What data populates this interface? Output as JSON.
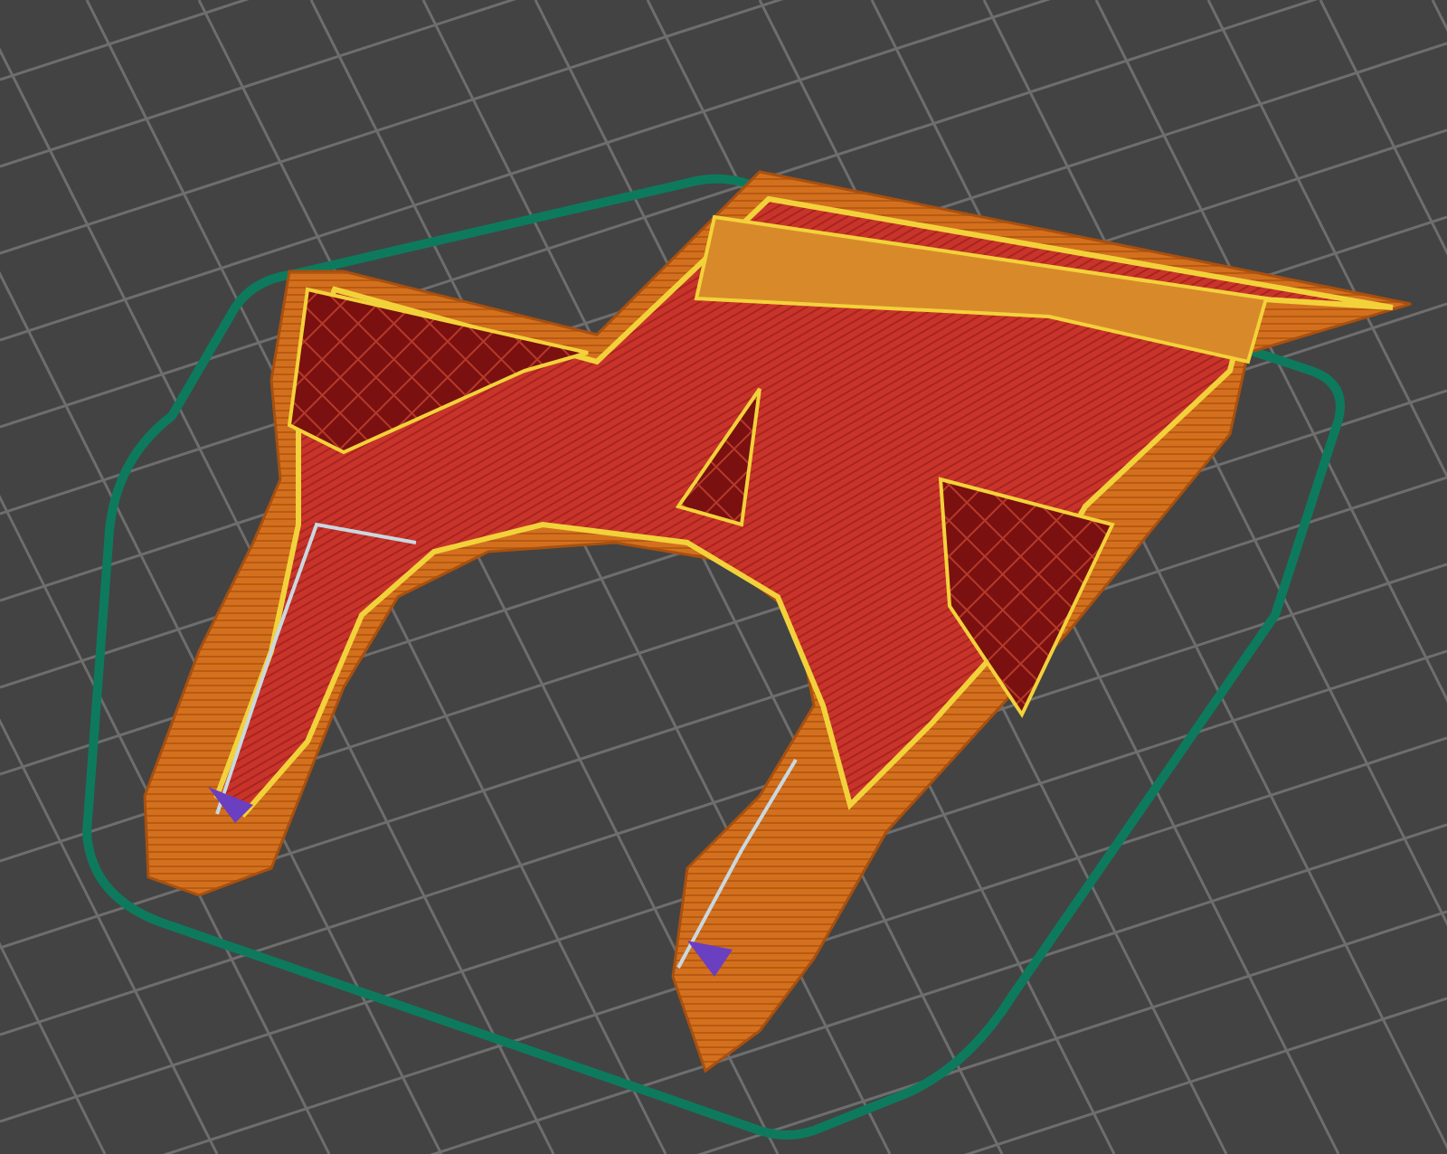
{
  "viewport": {
    "kind": "toolpath-preview"
  }
}
